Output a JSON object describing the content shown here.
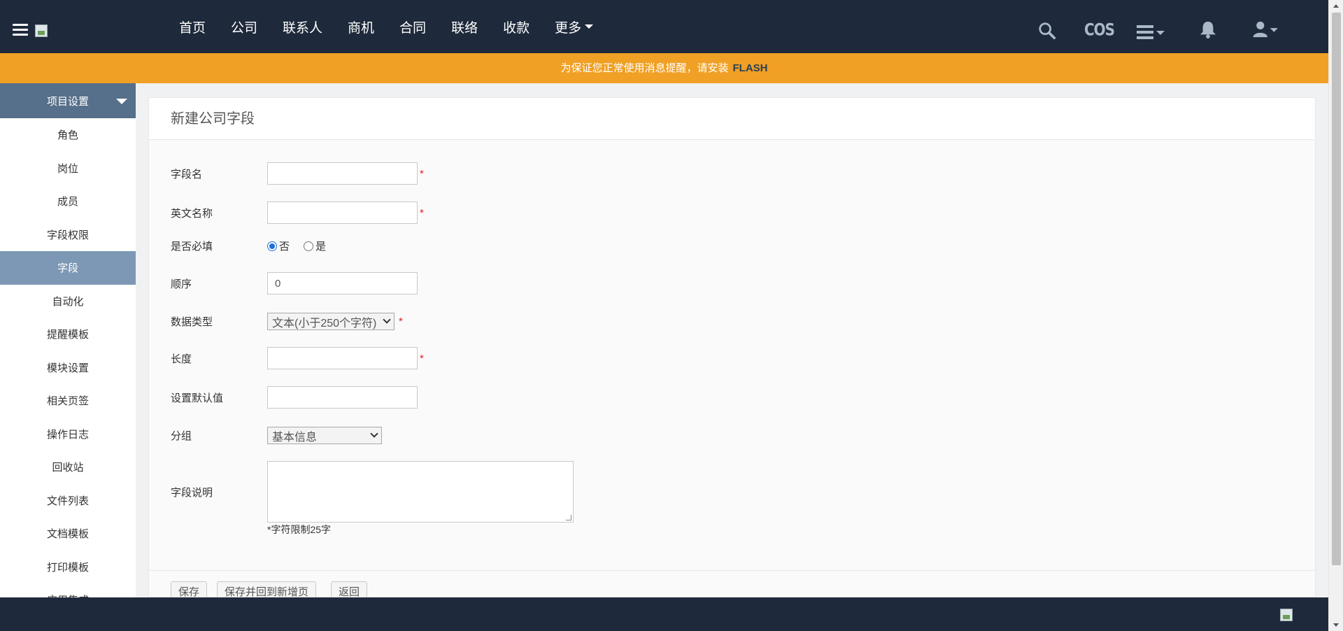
{
  "topbar": {
    "nav": [
      {
        "label": "首页"
      },
      {
        "label": "公司"
      },
      {
        "label": "联系人"
      },
      {
        "label": "商机"
      },
      {
        "label": "合同"
      },
      {
        "label": "联络"
      },
      {
        "label": "收款"
      },
      {
        "label": "更多"
      }
    ],
    "cos_label": "COS",
    "icons": [
      "search-icon",
      "cos-icon",
      "list-menu-icon",
      "bell-icon",
      "user-icon"
    ]
  },
  "banner": {
    "text": "为保证您正常使用消息提醒，请安装",
    "link": "FLASH"
  },
  "sidebar": {
    "title": "项目设置",
    "items": [
      {
        "label": "角色"
      },
      {
        "label": "岗位"
      },
      {
        "label": "成员"
      },
      {
        "label": "字段权限"
      },
      {
        "label": "字段",
        "active": true
      },
      {
        "label": "自动化"
      },
      {
        "label": "提醒模板"
      },
      {
        "label": "模块设置"
      },
      {
        "label": "相关页签"
      },
      {
        "label": "操作日志"
      },
      {
        "label": "回收站"
      },
      {
        "label": "文件列表"
      },
      {
        "label": "文档模板"
      },
      {
        "label": "打印模板"
      },
      {
        "label": "应用集成"
      }
    ]
  },
  "form": {
    "title": "新建公司字段",
    "field_name": {
      "label": "字段名",
      "value": ""
    },
    "english_name": {
      "label": "英文名称",
      "value": ""
    },
    "required": {
      "label": "是否必填",
      "options": [
        "否",
        "是"
      ],
      "selected": "否"
    },
    "order": {
      "label": "顺序",
      "value": "0"
    },
    "data_type": {
      "label": "数据类型",
      "selected": "文本(小于250个字符)"
    },
    "length": {
      "label": "长度",
      "value": ""
    },
    "default_value": {
      "label": "设置默认值",
      "value": ""
    },
    "group": {
      "label": "分组",
      "selected": "基本信息"
    },
    "description": {
      "label": "字段说明",
      "value": "",
      "hint": "*字符限制25字"
    },
    "required_mark": "*"
  },
  "buttons": {
    "save": "保存",
    "save_and_new": "保存并回到新增页",
    "back": "返回"
  },
  "colors": {
    "topbar_bg": "#1e2a3b",
    "banner_bg": "#f0a024",
    "sidebar_head_bg": "#566f8a",
    "sidebar_active_bg": "#7d98b5"
  }
}
